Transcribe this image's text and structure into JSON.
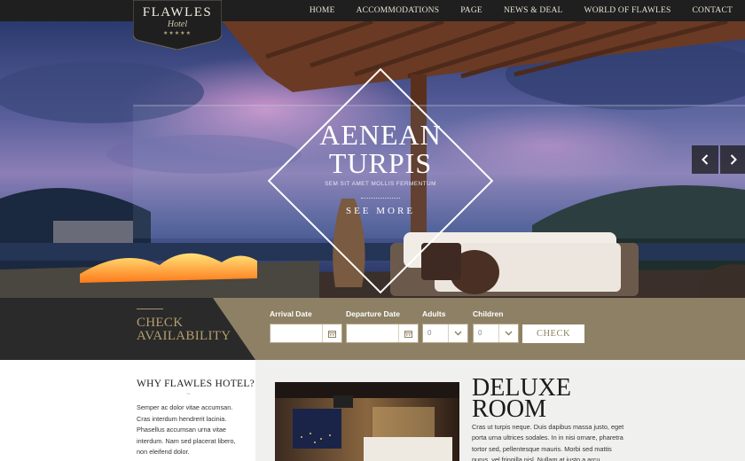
{
  "brand": {
    "name": "FLAWLES",
    "sub": "Hotel",
    "stars": "★★★★★"
  },
  "nav": {
    "items": [
      "HOME",
      "ACCOMMODATIONS",
      "PAGE",
      "NEWS & DEAL",
      "WORLD OF FLAWLES",
      "CONTACT"
    ]
  },
  "hero": {
    "title": "AENEAN TURPIS",
    "subtitle": "SEM SIT AMET MOLLIS FERMENTUM",
    "cta": "SEE MORE"
  },
  "booking": {
    "title": "CHECK AVAILABILITY",
    "arrival_label": "Arrival Date",
    "departure_label": "Departure Date",
    "adults_label": "Adults",
    "adults_value": "0",
    "children_label": "Children",
    "children_value": "0",
    "check_label": "CHECK"
  },
  "why": {
    "title": "WHY FLAWLES HOTEL?",
    "separator": "~",
    "text": "Semper ac dolor vitae accumsan. Cras interdum hendrerit lacinia. Phasellus accumsan urna vitae interdum. Nam sed placerat libero, non eleifend dolor."
  },
  "room": {
    "title": "DELUXE ROOM",
    "text": "Cras ut turpis neque. Duis dapibus massa justo, eget porta urna ultrices sodales. In in nisi ornare, pharetra tortor sed, pellentesque mauris. Morbi sed mattis purus, vel fringilla nisl. Nullam at justo a arcu ullamcorper lacinia"
  },
  "colors": {
    "gold": "#8e8064",
    "dark": "#2a2a2a",
    "nav": "#1f1f1f"
  }
}
